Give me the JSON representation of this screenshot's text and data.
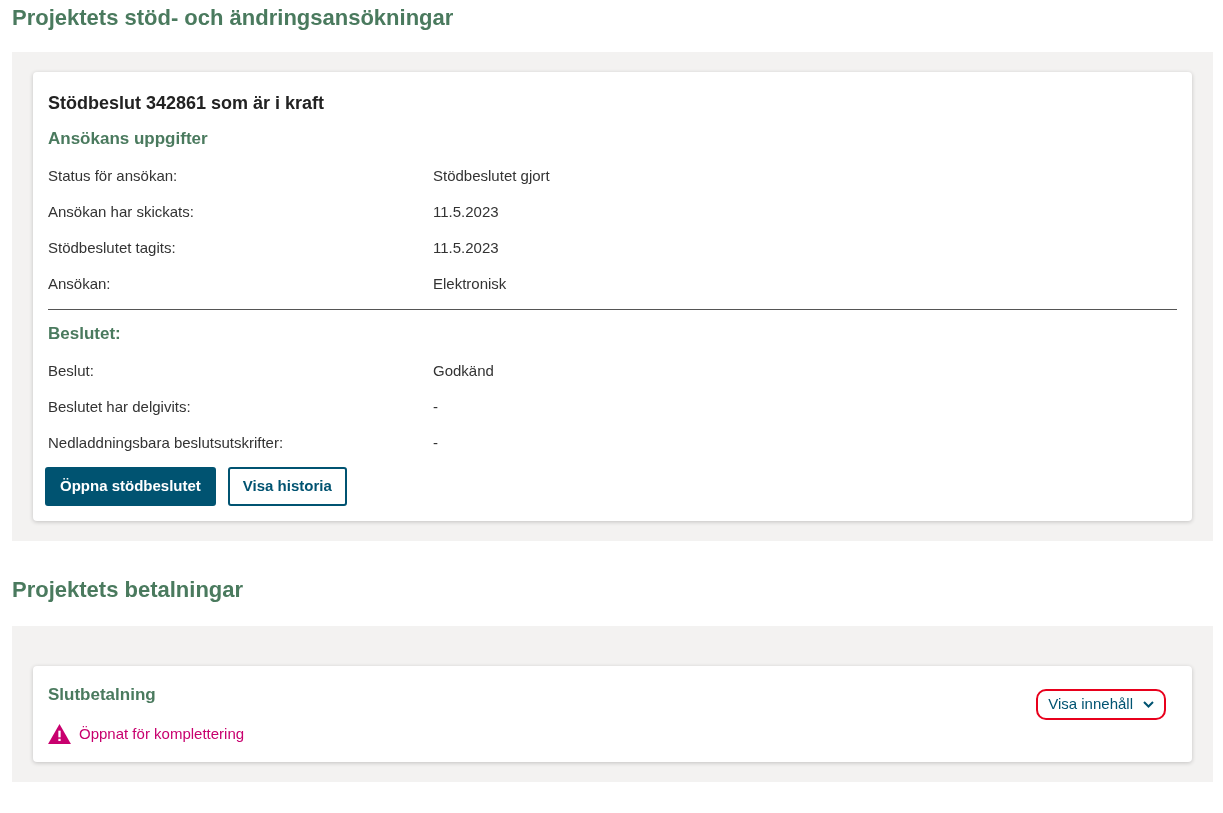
{
  "sections": [
    {
      "title": "Projektets stöd- och ändringsansökningar",
      "kind": "decision",
      "card": {
        "title": "Stödbeslut 342861 som är i kraft",
        "groups": [
          {
            "heading": "Ansökans uppgifter",
            "rows": [
              {
                "label": "Status för ansökan:",
                "value": "Stödbeslutet gjort"
              },
              {
                "label": "Ansökan har skickats:",
                "value": "11.5.2023"
              },
              {
                "label": "Stödbeslutet tagits:",
                "value": "11.5.2023"
              },
              {
                "label": "Ansökan:",
                "value": "Elektronisk"
              }
            ]
          },
          {
            "heading": "Beslutet:",
            "rows": [
              {
                "label": "Beslut:",
                "value": "Godkänd"
              },
              {
                "label": "Beslutet har delgivits:",
                "value": "-"
              },
              {
                "label": "Nedladdningsbara beslutsutskrifter:",
                "value": "-"
              }
            ]
          }
        ],
        "buttons": [
          {
            "label": "Öppna stödbeslutet",
            "kind": "primary"
          },
          {
            "label": "Visa historia",
            "kind": "secondary"
          }
        ]
      }
    },
    {
      "title": "Projektets betalningar",
      "kind": "payment",
      "card": {
        "title": "Slutbetalning",
        "status": "Öppnat för komplettering",
        "toggle": {
          "label": "Visa innehåll",
          "expanded": false,
          "focused": true
        }
      }
    }
  ]
}
